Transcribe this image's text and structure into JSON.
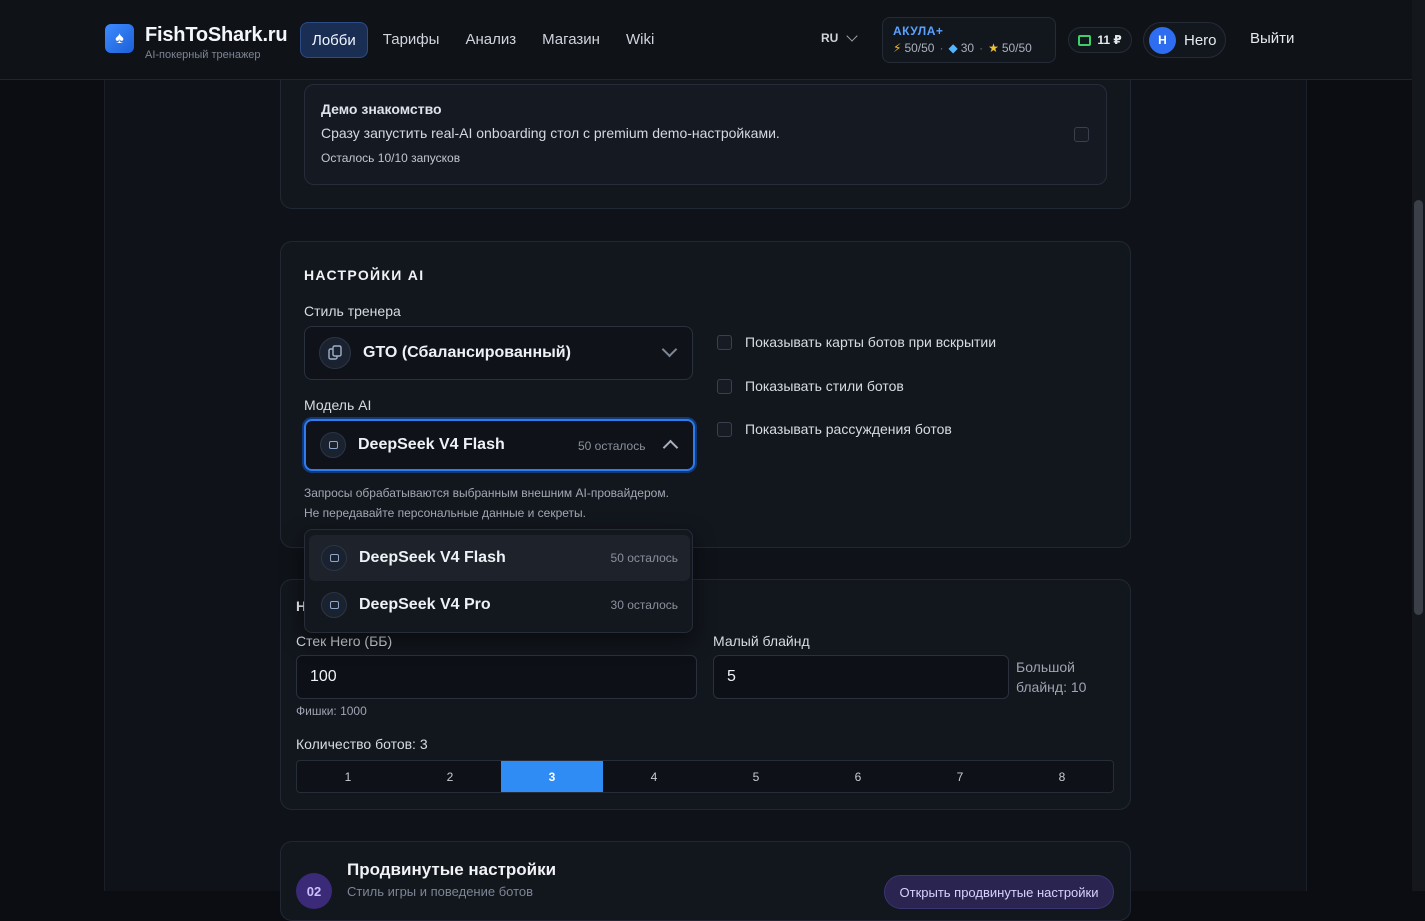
{
  "header": {
    "logo_glyph": "♠",
    "brand_title": "FishToShark.ru",
    "brand_subtitle": "AI-покерный тренажер",
    "nav": [
      {
        "label": "Лобби",
        "active": true
      },
      {
        "label": "Тарифы",
        "active": false
      },
      {
        "label": "Анализ",
        "active": false
      },
      {
        "label": "Магазин",
        "active": false
      },
      {
        "label": "Wiki",
        "active": false
      }
    ],
    "language": "RU",
    "plan": {
      "name": "АКУЛА+",
      "energy": "50/50",
      "gems": "30",
      "stars": "50/50",
      "separator": "·"
    },
    "wallet": "11 ₽",
    "user": {
      "avatar_letter": "H",
      "name": "Hero"
    },
    "logout_label": "Выйти"
  },
  "demo": {
    "title": "Демо знакомство",
    "description": "Сразу запустить real-AI onboarding стол с premium demo-настройками.",
    "note": "Осталось 10/10 запусков",
    "checked": false
  },
  "ai_settings": {
    "title": "НАСТРОЙКИ AI",
    "coach_style_label": "Стиль тренера",
    "coach_style_value": "GTO (Сбалансированный)",
    "model_label": "Модель AI",
    "model_value": "DeepSeek V4 Flash",
    "model_remaining": "50 осталось",
    "hint_line1": "Запросы обрабатываются выбранным внешним AI-провайдером.",
    "hint_line2": "Не передавайте персональные данные и секреты.",
    "options": [
      {
        "label": "Показывать карты ботов при вскрытии",
        "checked": false
      },
      {
        "label": "Показывать стили ботов",
        "checked": false
      },
      {
        "label": "Показывать рассуждения ботов",
        "checked": false
      }
    ],
    "model_dropdown": [
      {
        "label": "DeepSeek V4 Flash",
        "remaining": "50 осталось",
        "selected": true
      },
      {
        "label": "DeepSeek V4 Pro",
        "remaining": "30 осталось",
        "selected": false
      }
    ]
  },
  "game_settings": {
    "title_visible": "Н",
    "stack_label": "Стек Hero (ББ)",
    "stack_value": "100",
    "chips_note": "Фишки: 1000",
    "small_blind_label": "Малый блайнд",
    "small_blind_value": "5",
    "big_blind_line1": "Большой",
    "big_blind_line2": "блайнд: 10",
    "bots_label": "Количество ботов: 3",
    "bot_options": [
      "1",
      "2",
      "3",
      "4",
      "5",
      "6",
      "7",
      "8"
    ],
    "bots_selected": "3"
  },
  "advanced": {
    "number": "02",
    "title": "Продвинутые настройки",
    "description": "Стиль игры и поведение ботов",
    "button_label": "Открыть продвинутые настройки"
  }
}
